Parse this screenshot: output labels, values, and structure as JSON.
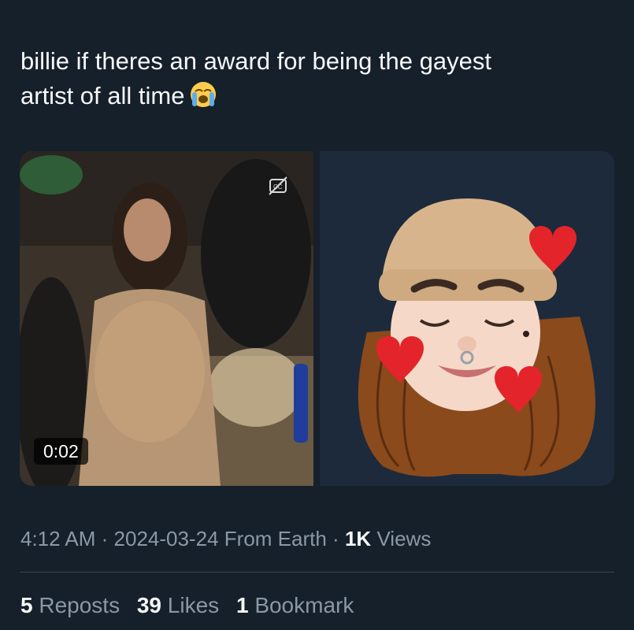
{
  "tweet": {
    "text_line1": "billie if theres an award for being the gayest",
    "text_line2": "artist of all time",
    "emoji": "loudly-crying-face-emoji"
  },
  "media": {
    "video_duration": "0:02",
    "cc_icon": "captions-off-icon",
    "image_description_icon": "memoji-avatar-with-hearts"
  },
  "meta": {
    "time": "4:12 AM",
    "separator": "·",
    "date": "2024-03-24",
    "location": "From Earth",
    "views_count": "1K",
    "views_label": "Views"
  },
  "stats": {
    "reposts_count": "5",
    "reposts_label": "Reposts",
    "likes_count": "39",
    "likes_label": "Likes",
    "bookmarks_count": "1",
    "bookmarks_label": "Bookmark"
  },
  "colors": {
    "background": "#15202b",
    "text_primary": "#f7f9f9",
    "text_secondary": "#8b98a5",
    "divider": "#38444d"
  }
}
